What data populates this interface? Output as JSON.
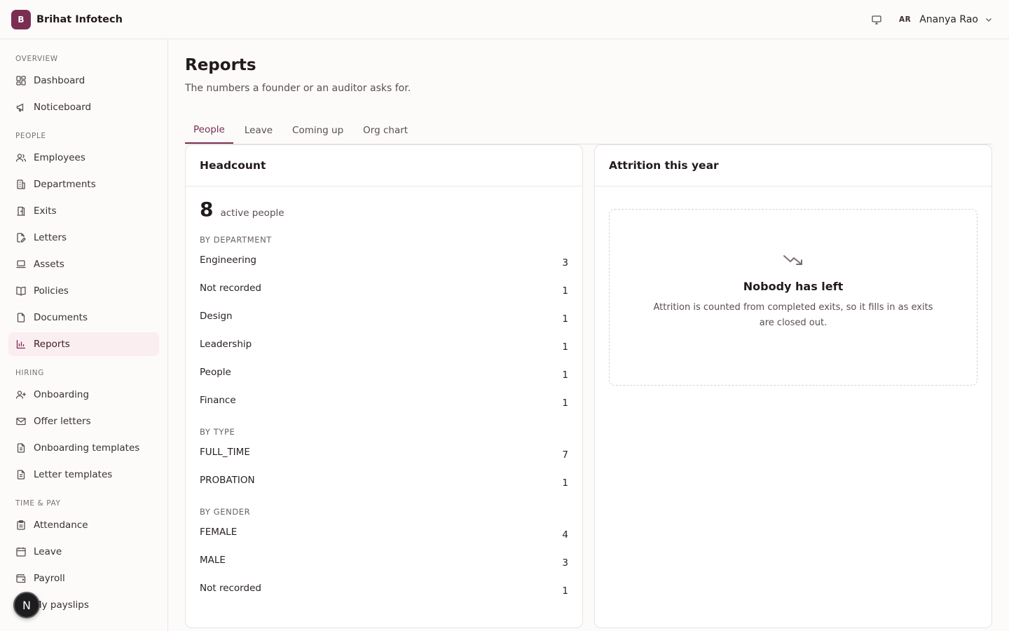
{
  "brand": {
    "initial": "B",
    "name": "Brihat Infotech",
    "color": "#7a2e52"
  },
  "user": {
    "initials": "AR",
    "name": "Ananya Rao"
  },
  "sidebar": {
    "sections": {
      "overview": "OVERVIEW",
      "people": "PEOPLE",
      "hiring": "HIRING",
      "time_pay": "TIME & PAY"
    },
    "items": {
      "dashboard": "Dashboard",
      "noticeboard": "Noticeboard",
      "employees": "Employees",
      "departments": "Departments",
      "exits": "Exits",
      "letters": "Letters",
      "assets": "Assets",
      "policies": "Policies",
      "documents": "Documents",
      "reports": "Reports",
      "onboarding": "Onboarding",
      "offer_letters": "Offer letters",
      "onboarding_templates": "Onboarding templates",
      "letter_templates": "Letter templates",
      "attendance": "Attendance",
      "leave": "Leave",
      "payroll": "Payroll",
      "my_payslips": "My payslips"
    },
    "active": "reports"
  },
  "fab": {
    "label": "N"
  },
  "page": {
    "title": "Reports",
    "subtitle": "The numbers a founder or an auditor asks for."
  },
  "tabs": {
    "people": "People",
    "leave": "Leave",
    "coming_up": "Coming up",
    "org_chart": "Org chart",
    "active": "people"
  },
  "headcount": {
    "title": "Headcount",
    "total": "8",
    "total_label": "active people",
    "by_department_label": "BY DEPARTMENT",
    "by_department": [
      {
        "label": "Engineering",
        "count": "3"
      },
      {
        "label": "Not recorded",
        "count": "1"
      },
      {
        "label": "Design",
        "count": "1"
      },
      {
        "label": "Leadership",
        "count": "1"
      },
      {
        "label": "People",
        "count": "1"
      },
      {
        "label": "Finance",
        "count": "1"
      }
    ],
    "by_type_label": "BY TYPE",
    "by_type": [
      {
        "label": "FULL_TIME",
        "count": "7"
      },
      {
        "label": "PROBATION",
        "count": "1"
      }
    ],
    "by_gender_label": "BY GENDER",
    "by_gender": [
      {
        "label": "FEMALE",
        "count": "4"
      },
      {
        "label": "MALE",
        "count": "3"
      },
      {
        "label": "Not recorded",
        "count": "1"
      }
    ]
  },
  "attrition": {
    "title": "Attrition this year",
    "empty_title": "Nobody has left",
    "empty_text": "Attrition is counted from completed exits, so it fills in as exits are closed out."
  },
  "colors": {
    "accent": "#7a2e52",
    "active_bg": "#fbeef1"
  }
}
